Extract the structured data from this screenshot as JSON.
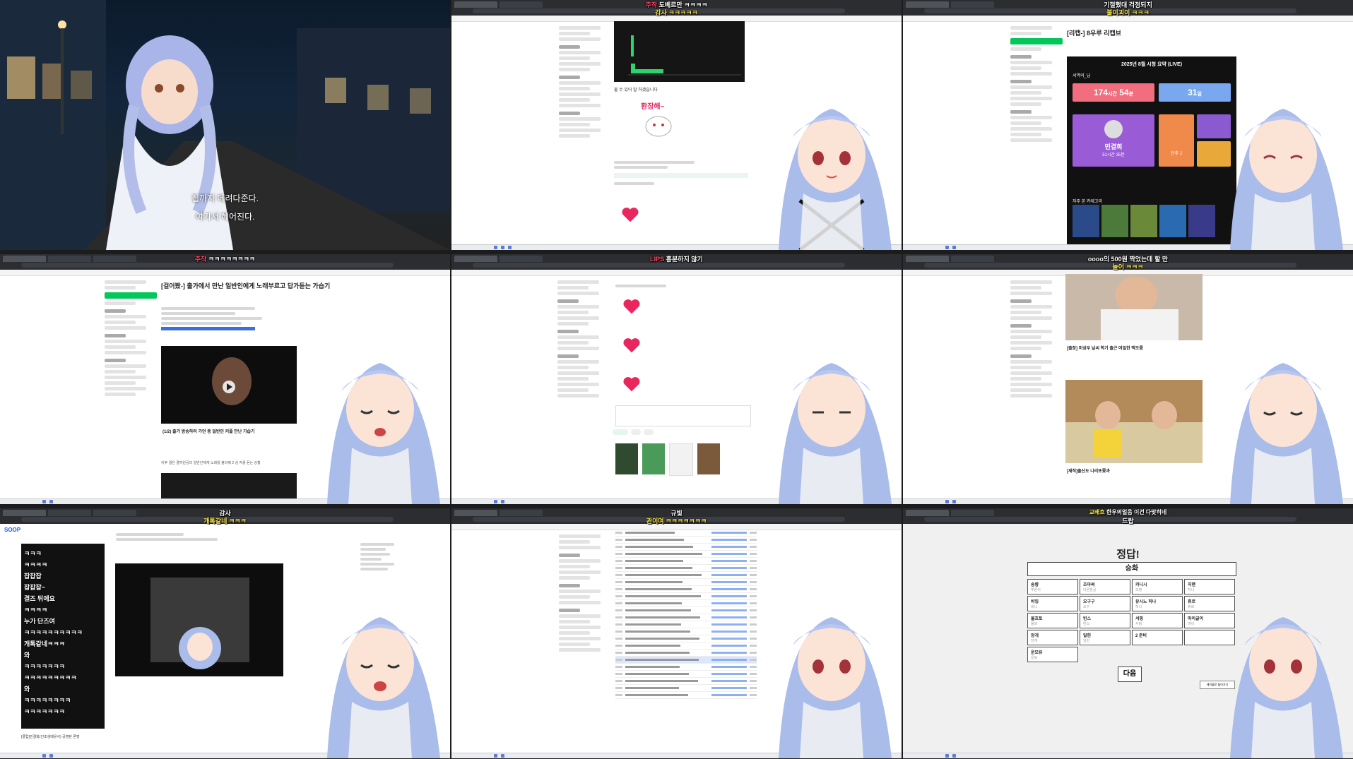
{
  "captions": [
    {
      "id": "t1",
      "text": ""
    },
    {
      "id": "t2",
      "parts": [
        "주작",
        "도베르만 ㅋㅋㅋㅋ"
      ],
      "line2": "감사 ㅋㅋㅋㅋㅋ"
    },
    {
      "id": "t3",
      "line1": "기절했대 걱정되지",
      "line2": "불이괴이 ㅋㅋㅋ"
    },
    {
      "id": "t4",
      "parts": [
        "주작",
        "ㅋㅋㅋㅋㅋㅋㅋㅋ"
      ]
    },
    {
      "id": "t5",
      "parts": [
        "LIPS",
        "홍분하지 않기"
      ]
    },
    {
      "id": "t6",
      "line1": "oooo의 500원 짝었는데 할 만",
      "line2": "놀어 ㅋㅋㅋ"
    },
    {
      "id": "t7",
      "line1": "감사",
      "line2": "개톡같네 ㅋㅋㅋ"
    },
    {
      "id": "t8",
      "line1": "규빛",
      "line2": "관이며 ㅋㅋㅋㅋㅋㅋㅋ"
    },
    {
      "id": "t9",
      "line1": "교배흐",
      "line2": "한우의얼음 이건 다맞히네",
      "line3": "드랍"
    }
  ],
  "tile1": {
    "subtitle1": "집까지 데려다준다.",
    "subtitle2": "여기서 헤어진다."
  },
  "tile2": {
    "emote_text": "환장해~",
    "status": "불 수 있어 말 하겠습니다"
  },
  "tile3": {
    "post_title": "[리캡-] 8우루 리캡브",
    "card_title": "2025년 8월 시청 요약 (LIVE)",
    "name": "서역의_님",
    "hours": "174",
    "hours_unit": "시간",
    "minutes": "54",
    "minutes_unit": "분",
    "days": "31",
    "days_unit": "일",
    "top_name": "민결희",
    "top_time": "51시간 35분",
    "second_name": "단추 J",
    "games_label": "자주 본 카테고리"
  },
  "tile4": {
    "post_title": "[걸어봤-] 출가에서 만난 일반인에게 노래부르고 답가듣는 가습기",
    "video_caption": "(1/2) 출가 방송하러 가던 중 일반인 커플 만난 가습기",
    "footer_text": "이후 결은 결여원공의 일반인에게 노래를 불러줘 2 싱 자를 듣는 상황"
  },
  "tile6": {
    "caption1": "[출장] 미성우 날씨 학기 출근 여일한 맥오름",
    "caption2": "[재직]출산도 나리또쫓과"
  },
  "tile7": {
    "logo": "SOOP",
    "chat": [
      "ㅋㅋㅋ",
      "ㅋㅋㅋㅋ",
      "잡잡잡",
      "잡잡잡~",
      "결즈 뒤에요",
      "ㅋㅋㅋㅋ",
      "누가 단즈여",
      "ㅋㅋㅋㅋㅋㅋㅋㅋㅋㅋ",
      "개톡같네ㅋㅋㅋ",
      "와",
      "ㅋㅋㅋㅋㅋㅋㅋ",
      "ㅋㅋㅋㅋㅋㅋㅋㅋㅋ",
      "와",
      "ㅋㅋㅋㅋㅋㅋㅋㅋ",
      "ㅋㅋㅋㅋㅋㅋㅋ"
    ],
    "bottom_text": "[클립]민결희(인조생태유사) 공명된 론명"
  },
  "tile9": {
    "header": "정답!",
    "answer": "승화",
    "cells": [
      {
        "top": "송향",
        "bot": "푸른이"
      },
      {
        "top": "조아써",
        "bot": "다른한궁"
      },
      {
        "top": "카니시",
        "bot": "초명"
      },
      {
        "top": "지맨",
        "bot": "지니"
      },
      {
        "top": "비잉",
        "bot": "비니"
      },
      {
        "top": "오구구",
        "bot": "오구"
      },
      {
        "top": "유시노 히나",
        "bot": "히나"
      },
      {
        "top": "휴르",
        "bot": "휴르"
      },
      {
        "top": "물흐토",
        "bot": "물흐"
      },
      {
        "top": "빈스",
        "bot": "빈스"
      },
      {
        "top": "서핑",
        "bot": "서핑"
      },
      {
        "top": "마이글이",
        "bot": "마이"
      },
      {
        "top": "앙개",
        "bot": "앙개"
      },
      {
        "top": "일헌",
        "bot": "일헌"
      },
      {
        "top": "2 준비",
        "bot": ""
      },
      {
        "top": "",
        "bot": ""
      },
      {
        "top": "운모유",
        "bot": "운모"
      }
    ],
    "next_button": "다음",
    "corner_button": "테이블로 돌아가기"
  },
  "colors": {
    "accent_green": "#03c75a",
    "heart_pink": "#e8275f",
    "stat_pink": "#f26d7d",
    "stat_blue": "#7aa8f0",
    "card_purple": "#9a5bd6"
  }
}
